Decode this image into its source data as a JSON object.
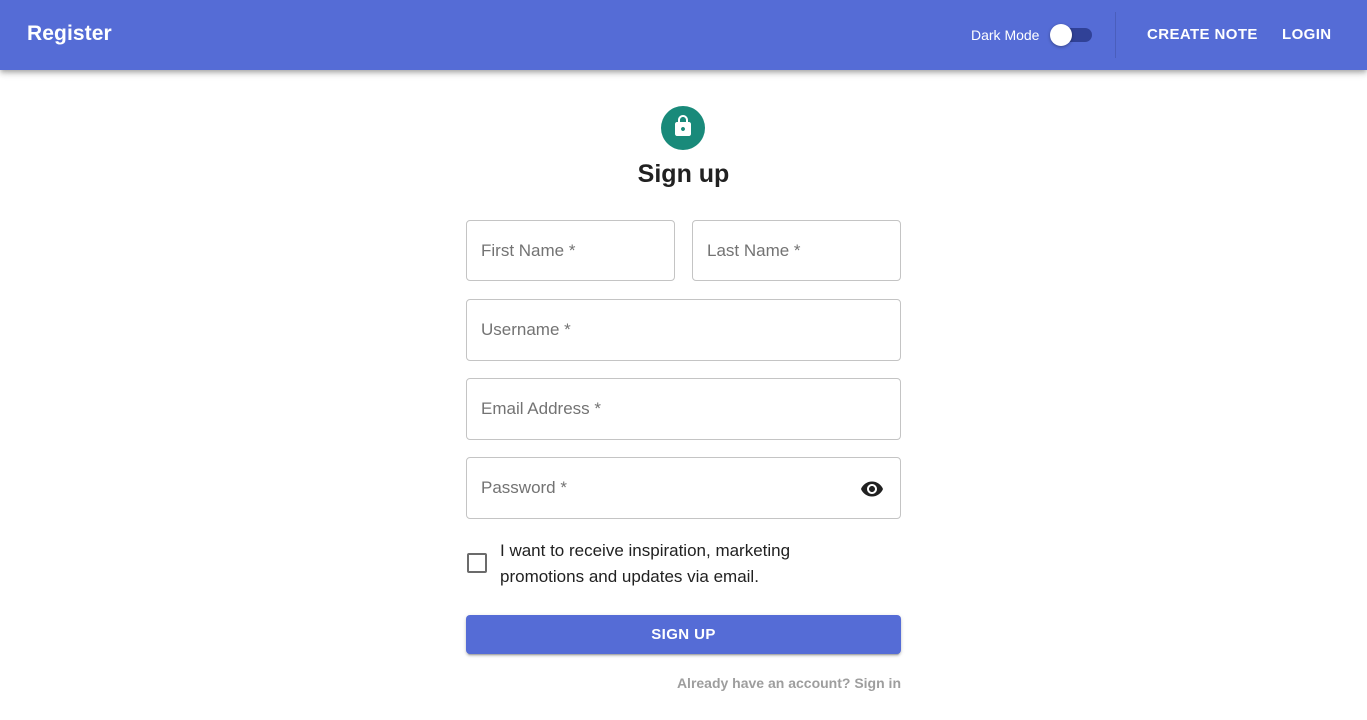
{
  "appbar": {
    "title": "Register",
    "dark_mode_label": "Dark Mode",
    "dark_mode_on": false,
    "nav": {
      "create_note": "CREATE NOTE",
      "login": "LOGIN"
    }
  },
  "form": {
    "icon": "lock-icon",
    "heading": "Sign up",
    "fields": {
      "first_name": "First Name *",
      "last_name": "Last Name *",
      "username": "Username *",
      "email": "Email Address *",
      "password": "Password *"
    },
    "password_toggle_icon": "eye-icon",
    "marketing_checkbox_label": "I want to receive inspiration, marketing promotions and updates via email.",
    "marketing_checked": false,
    "submit_label": "SIGN UP",
    "signin_link": "Already have an account? Sign in"
  },
  "colors": {
    "primary": "#556cd6",
    "avatar": "#198a7a"
  }
}
